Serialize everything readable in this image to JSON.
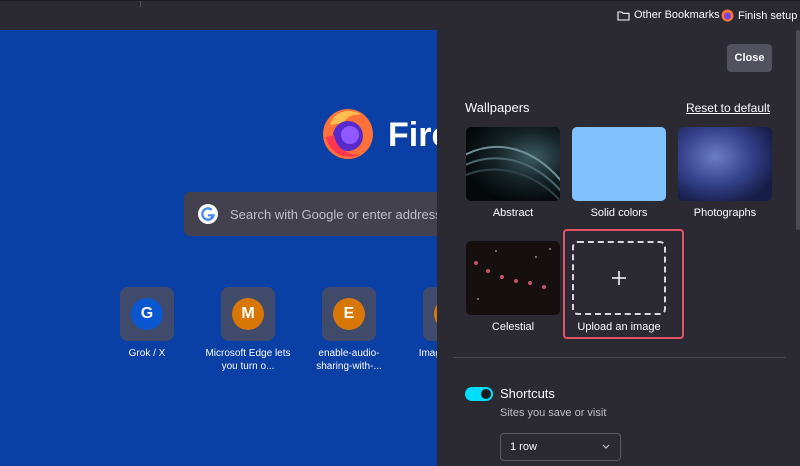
{
  "bookmarks_bar": {
    "other_bookmarks": "Other Bookmarks",
    "finish_setup": "Finish setup"
  },
  "new_tab": {
    "logo_text": "Fire",
    "search_placeholder": "Search with Google or enter address",
    "shortcuts": [
      {
        "letter": "G",
        "label": "Grok / X",
        "color": "#0b57d0"
      },
      {
        "letter": "M",
        "label": "Microsoft Edge lets you turn o...",
        "color": "#d97706"
      },
      {
        "letter": "E",
        "label": "enable-audio-sharing-with-...",
        "color": "#d97706"
      },
      {
        "letter": "",
        "label": "Imag... Tech...",
        "color": "#d97706"
      }
    ]
  },
  "panel": {
    "close_label": "Close",
    "wallpapers_heading": "Wallpapers",
    "reset_label": "Reset to default",
    "wallpapers": [
      {
        "label": "Abstract"
      },
      {
        "label": "Solid colors"
      },
      {
        "label": "Photographs"
      },
      {
        "label": "Celestial"
      },
      {
        "label": "Upload an image"
      }
    ],
    "shortcuts": {
      "heading": "Shortcuts",
      "subtitle": "Sites you save or visit",
      "enabled": true,
      "rows_value": "1 row"
    }
  },
  "colors": {
    "page_bg": "#0a3fa6",
    "panel_bg": "#2b2a33",
    "accent_toggle": "#00ddff",
    "highlight": "#e25567"
  }
}
